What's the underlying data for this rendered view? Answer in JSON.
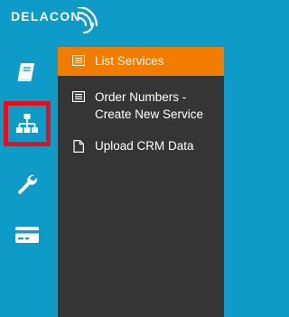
{
  "brand": {
    "name": "DELACON"
  },
  "rail": {
    "items": [
      {
        "name": "book",
        "active": false
      },
      {
        "name": "sitemap",
        "active": true
      },
      {
        "name": "wrench",
        "active": false
      },
      {
        "name": "credit-card",
        "active": false
      }
    ],
    "highlight_color": "#e4101b"
  },
  "submenu": {
    "items": [
      {
        "label": "List Services",
        "icon": "list-icon",
        "active": true
      },
      {
        "label": "Order Numbers - Create New Service",
        "icon": "list-icon",
        "active": false
      },
      {
        "label": "Upload CRM Data",
        "icon": "file-icon",
        "active": false
      }
    ]
  },
  "colors": {
    "rail_bg": "#0f9bc8",
    "submenu_bg": "#353535",
    "active_item": "#f07d00"
  }
}
